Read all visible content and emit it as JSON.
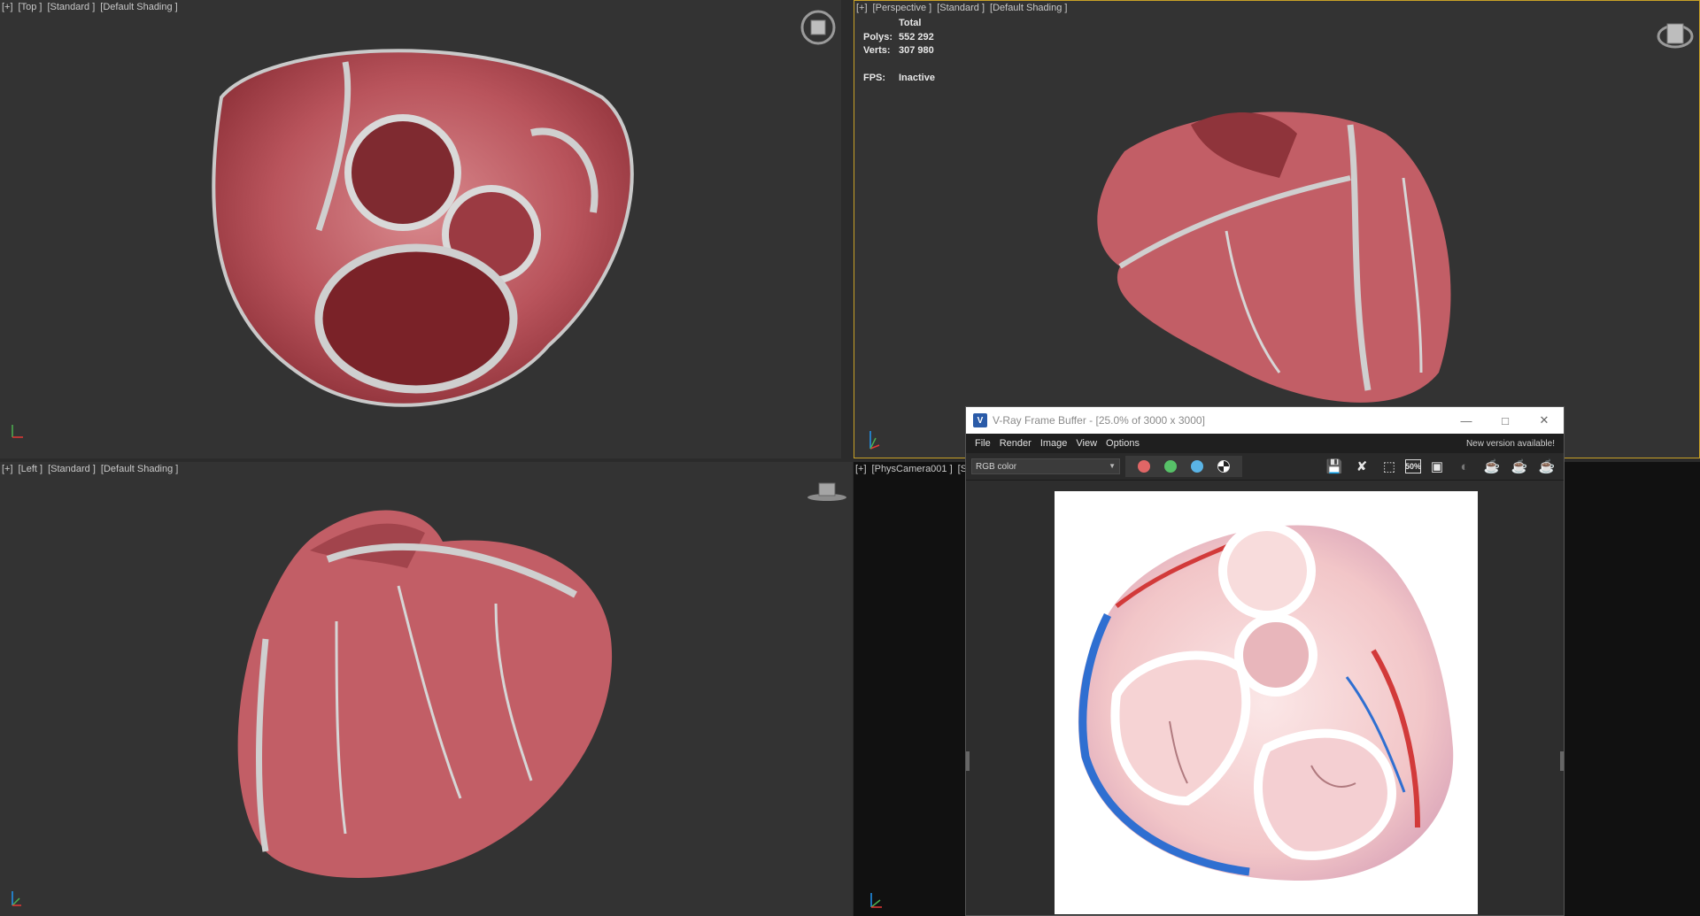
{
  "viewports": {
    "top": {
      "labels": [
        "[+]",
        "[Top ]",
        "[Standard ]",
        "[Default Shading ]"
      ]
    },
    "perspective": {
      "labels": [
        "[+]",
        "[Perspective ]",
        "[Standard ]",
        "[Default Shading ]"
      ]
    },
    "left": {
      "labels": [
        "[+]",
        "[Left ]",
        "[Standard ]",
        "[Default Shading ]"
      ]
    },
    "camera": {
      "labels": [
        "[+]",
        "[PhysCamera001 ]",
        "[St"
      ]
    }
  },
  "stats": {
    "total_label": "Total",
    "polys_label": "Polys:",
    "polys_value": "552 292",
    "verts_label": "Verts:",
    "verts_value": "307 980",
    "fps_label": "FPS:",
    "fps_value": "Inactive"
  },
  "vfb": {
    "logo": "V",
    "title": "V-Ray Frame Buffer - [25.0% of 3000 x 3000]",
    "menu": [
      "File",
      "Render",
      "Image",
      "View",
      "Options"
    ],
    "notice": "New version available!",
    "channel": "RGB color",
    "zoom_tool_label": "50%",
    "colors": {
      "red": "#e06666",
      "green": "#57c168",
      "blue": "#5ab4e6"
    }
  }
}
